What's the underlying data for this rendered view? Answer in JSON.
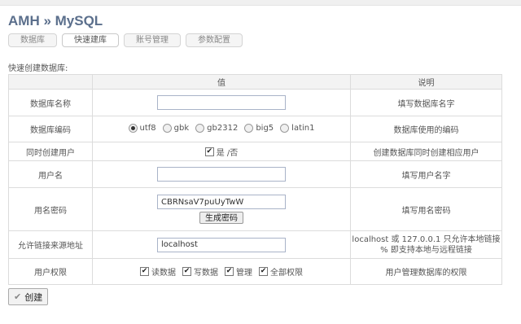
{
  "header": {
    "title": "AMH » MySQL"
  },
  "tabs": [
    {
      "label": "数据库",
      "active": false
    },
    {
      "label": "快速建库",
      "active": true
    },
    {
      "label": "账号管理",
      "active": false
    },
    {
      "label": "参数配置",
      "active": false
    }
  ],
  "section_label": "快速创建数据库:",
  "table": {
    "columns": [
      "",
      "值",
      "说明"
    ],
    "rows": {
      "db_name": {
        "label": "数据库名称",
        "value": "",
        "desc": "填写数据库名字"
      },
      "db_encoding": {
        "label": "数据库编码",
        "options": [
          "utf8",
          "gbk",
          "gb2312",
          "big5",
          "latin1"
        ],
        "selected": "utf8",
        "desc": "数据库使用的编码"
      },
      "create_user": {
        "label": "同时创建用户",
        "checked": true,
        "option_text": "是 /否",
        "desc": "创建数据库同时创建相应用户"
      },
      "username": {
        "label": "用户名",
        "value": "",
        "desc": "填写用户名字"
      },
      "password": {
        "label": "用名密码",
        "value": "CBRNsaV7puUyTwW",
        "gen_button": "生成密码",
        "desc": "填写用名密码"
      },
      "host": {
        "label": "允许链接来源地址",
        "value": "localhost",
        "desc_line1": "localhost 或 127.0.0.1 只允许本地链接",
        "desc_line2": "% 即支持本地与远程链接"
      },
      "permissions": {
        "label": "用户权限",
        "options": [
          {
            "label": "读数据",
            "checked": true
          },
          {
            "label": "写数据",
            "checked": true
          },
          {
            "label": "管理",
            "checked": true
          },
          {
            "label": "全部权限",
            "checked": true
          }
        ],
        "desc": "用户管理数据库的权限"
      }
    }
  },
  "submit": {
    "label": "创建"
  },
  "icons": {
    "check": "check-icon"
  }
}
